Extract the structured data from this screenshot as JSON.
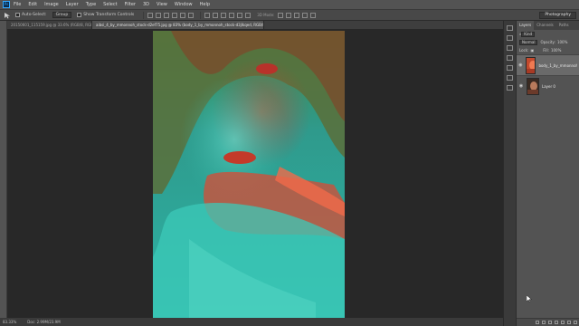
{
  "menubar": {
    "logo_text": "Ps",
    "items": [
      "File",
      "Edit",
      "Image",
      "Layer",
      "Type",
      "Select",
      "Filter",
      "3D",
      "View",
      "Window",
      "Help"
    ]
  },
  "options": {
    "auto_select_label": "Auto-Select:",
    "auto_select_value": "Group",
    "show_transform_label": "Show Transform Controls",
    "mode_3d_label": "3D Mode:",
    "workspace": "Photography"
  },
  "tabs": [
    {
      "label": "20150601_115159.jpg @ 33.6% (RGB/8, RGB/8) ×",
      "active": false
    },
    {
      "label": "aibsi_4_by_mmonnoh_stock-d2ef75.jpg @ 83% (body_1_by_mmonnoh_stock-d3jlkqed, RGB/8#) * ×",
      "active": true
    }
  ],
  "status": {
    "zoom": "83.33%",
    "doc": "Doc: 2.99M/23.9M"
  },
  "layers_panel": {
    "tabs": [
      "Layers",
      "Channels",
      "Paths"
    ],
    "kind_label": "Kind",
    "blend_mode": "Normal",
    "opacity_label": "Opacity:",
    "opacity_value": "100%",
    "lock_label": "Lock:",
    "fill_label": "Fill:",
    "fill_value": "100%",
    "layers": [
      {
        "name": "body_1_by_mmonnoh_st...",
        "visible": true,
        "selected": true
      },
      {
        "name": "Layer 0",
        "visible": true,
        "selected": false
      }
    ]
  },
  "colors": {
    "chrome_dark": "#282828",
    "panel_gray": "#535353",
    "photo_red": "#d8402a",
    "photo_teal": "#2fb7a6"
  }
}
